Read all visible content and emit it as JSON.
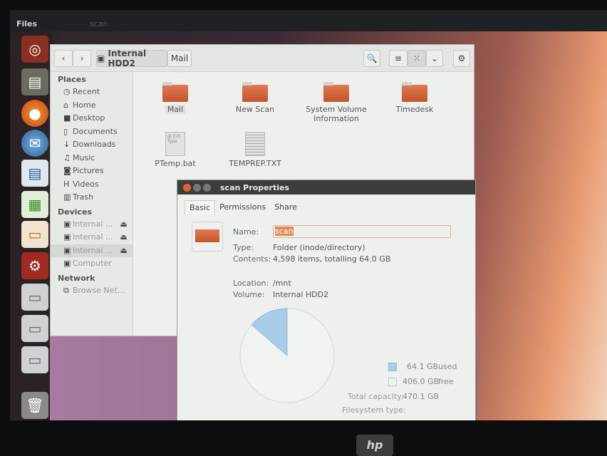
{
  "top_panel": {
    "app_title": "Files",
    "window_title": "scan"
  },
  "launcher": {
    "items": [
      "ubuntu-dash",
      "files",
      "firefox",
      "thunderbird",
      "libreoffice-writer",
      "libreoffice-calc",
      "libreoffice-impress",
      "system-settings",
      "drive",
      "drive",
      "drive",
      "trash"
    ]
  },
  "nautilus": {
    "breadcrumb": [
      "Internal HDD2",
      "Mail"
    ],
    "sidebar": {
      "places_header": "Places",
      "places": [
        {
          "icon": "clock",
          "label": "Recent"
        },
        {
          "icon": "home",
          "label": "Home"
        },
        {
          "icon": "folder",
          "label": "Desktop"
        },
        {
          "icon": "document",
          "label": "Documents"
        },
        {
          "icon": "download",
          "label": "Downloads"
        },
        {
          "icon": "music",
          "label": "Music"
        },
        {
          "icon": "camera",
          "label": "Pictures"
        },
        {
          "icon": "film",
          "label": "Videos"
        },
        {
          "icon": "trash",
          "label": "Trash"
        }
      ],
      "devices_header": "Devices",
      "devices": [
        {
          "label": "Internal ..."
        },
        {
          "label": "Internal ..."
        },
        {
          "label": "Internal ..."
        },
        {
          "label": "Computer"
        }
      ],
      "network_header": "Network",
      "network": [
        {
          "label": "Browse Net..."
        }
      ]
    },
    "files": [
      {
        "name": "Mail",
        "type": "folder"
      },
      {
        "name": "New Scan",
        "type": "folder"
      },
      {
        "name": "System Volume Information",
        "type": "folder"
      },
      {
        "name": "Timedesk",
        "type": "folder"
      },
      {
        "name": "PTemp.bat",
        "type": "file",
        "preview": "@ Ech Type"
      },
      {
        "name": "TEMPREP.TXT",
        "type": "text"
      }
    ]
  },
  "properties": {
    "title": "scan Properties",
    "tabs": [
      "Basic",
      "Permissions",
      "Share"
    ],
    "name_label": "Name:",
    "name_value": "scan",
    "type_label": "Type:",
    "type_value": "Folder (inode/directory)",
    "contents_label": "Contents:",
    "contents_value": "4,598 items, totalling 64.0 GB",
    "location_label": "Location:",
    "location_value": "/mnt",
    "volume_label": "Volume:",
    "volume_value": "Internal HDD2",
    "used_value": "64.1 GB",
    "used_label": "used",
    "free_value": "406.0 GB",
    "free_label": "free",
    "capacity_label": "Total capacity:",
    "capacity_value": "470.1 GB",
    "fs_label": "Filesystem type:",
    "used_color": "#a9cce8",
    "used_fraction": 0.136
  },
  "bezel": {
    "logo": "hp"
  }
}
